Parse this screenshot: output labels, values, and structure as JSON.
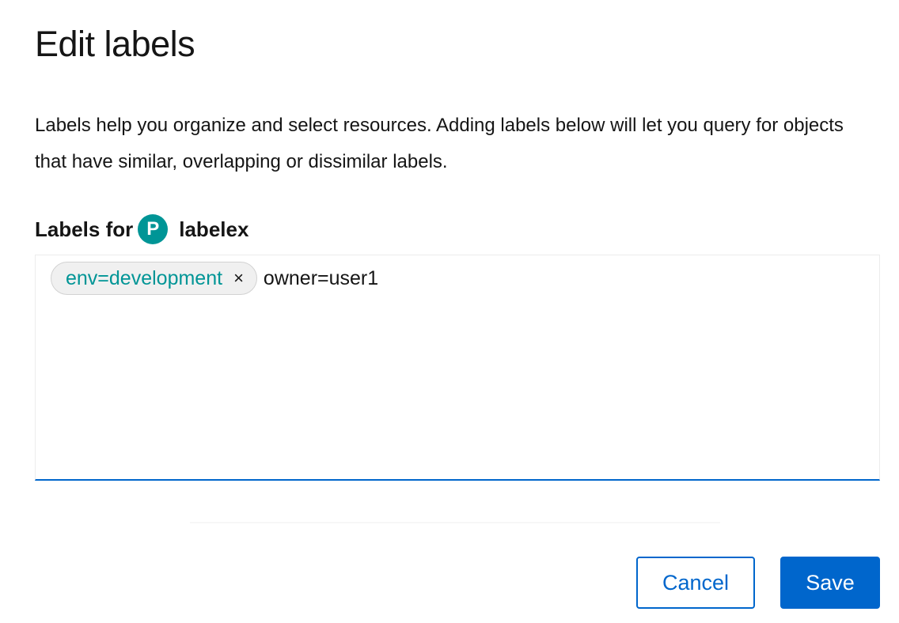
{
  "modal": {
    "title": "Edit labels",
    "description": "Labels help you organize and select resources. Adding labels below will let you query for objects that have similar, overlapping or dissimilar labels."
  },
  "labels_for": {
    "prefix": "Labels for",
    "badge": "P",
    "resource_name": "labelex"
  },
  "labels_input": {
    "tags": [
      {
        "text": "env=development",
        "remove_glyph": "×"
      }
    ],
    "current_value": "owner=user1"
  },
  "footer": {
    "cancel_label": "Cancel",
    "save_label": "Save"
  },
  "colors": {
    "primary": "#0066cc",
    "tag_text": "#009596",
    "badge_bg": "#009596"
  }
}
